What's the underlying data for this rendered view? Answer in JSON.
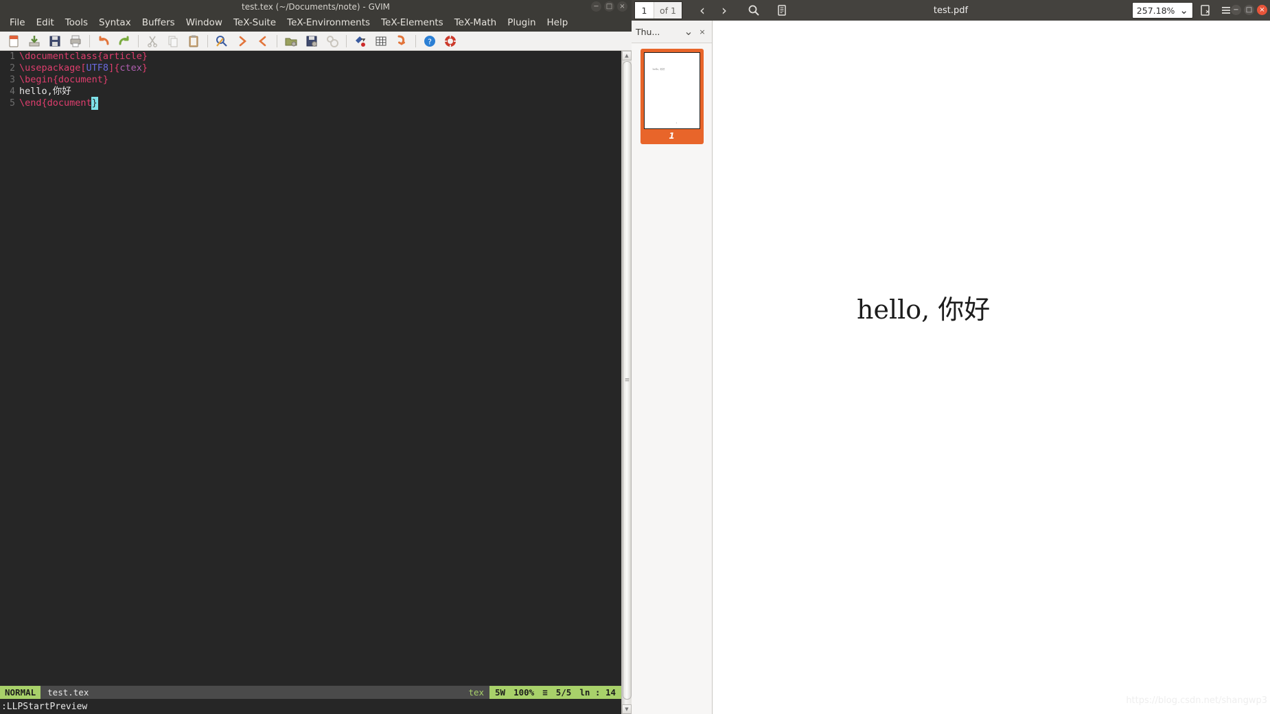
{
  "editor_window": {
    "title": "test.tex (~/Documents/note) - GVIM",
    "window_controls": [
      {
        "name": "minimize",
        "glyph": "−"
      },
      {
        "name": "maximize",
        "glyph": "□"
      },
      {
        "name": "close",
        "glyph": "×"
      }
    ],
    "menu": [
      "File",
      "Edit",
      "Tools",
      "Syntax",
      "Buffers",
      "Window",
      "TeX-Suite",
      "TeX-Environments",
      "TeX-Elements",
      "TeX-Math",
      "Plugin",
      "Help"
    ],
    "toolbar_icons": [
      "new-file-icon",
      "open-file-icon",
      "save-icon",
      "print-icon",
      "separator",
      "undo-icon",
      "redo-icon",
      "separator",
      "cut-icon",
      "copy-icon",
      "paste-icon",
      "separator",
      "find-icon",
      "find-next-icon",
      "find-previous-icon",
      "separator",
      "load-session-icon",
      "save-session-icon",
      "run-script-icon",
      "separator",
      "make-icon",
      "tags-icon",
      "run-icon",
      "separator",
      "help-icon",
      "find-help-icon"
    ],
    "code": [
      {
        "number": "1",
        "tokens": [
          {
            "text": "\\documentclass",
            "cls": "tk-cmd"
          },
          {
            "text": "{article}",
            "cls": "tk-brace"
          }
        ]
      },
      {
        "number": "2",
        "tokens": [
          {
            "text": "\\usepackage",
            "cls": "tk-cmd"
          },
          {
            "text": "[",
            "cls": "tk-brace"
          },
          {
            "text": "UTF8",
            "cls": "tk-opt"
          },
          {
            "text": "]",
            "cls": "tk-brace"
          },
          {
            "text": "{",
            "cls": "tk-brace"
          },
          {
            "text": "ctex",
            "cls": "tk-arg"
          },
          {
            "text": "}",
            "cls": "tk-brace"
          }
        ]
      },
      {
        "number": "3",
        "tokens": [
          {
            "text": "\\begin",
            "cls": "tk-cmd"
          },
          {
            "text": "{document}",
            "cls": "tk-brace"
          }
        ]
      },
      {
        "number": "4",
        "tokens": [
          {
            "text": "hello,你好",
            "cls": "tk-plain"
          }
        ]
      },
      {
        "number": "5",
        "tokens": [
          {
            "text": "\\end",
            "cls": "tk-cmd"
          },
          {
            "text": "{document",
            "cls": "tk-brace"
          },
          {
            "text": "}",
            "cls": "cursor-blk"
          }
        ]
      }
    ],
    "statusline": {
      "mode": "NORMAL",
      "filename": "test.tex",
      "filetype": "tex",
      "encoding_tag": "5W",
      "percent": "100%",
      "list_icon": "≡",
      "position": "5/5",
      "column_label": "ln  :  14"
    },
    "command_line": ":LLPStartPreview",
    "scrollbar": {
      "up_arrow": "▲",
      "down_arrow": "▼",
      "grip": "≡"
    }
  },
  "pdf_window": {
    "title": "test.pdf",
    "page_current": "1",
    "page_total": "of 1",
    "toolbar_buttons": [
      {
        "name": "previous-page-icon",
        "glyph": "‹"
      },
      {
        "name": "next-page-icon",
        "glyph": "›"
      },
      {
        "name": "search-icon",
        "glyph": "⚲"
      },
      {
        "name": "annotations-icon",
        "glyph": "☷"
      }
    ],
    "zoom": "257.18%",
    "zoom_caret": "⌄",
    "right_buttons": [
      {
        "name": "presentation-mode-icon",
        "glyph": "⧉"
      },
      {
        "name": "menu-icon",
        "glyph": "☰"
      }
    ],
    "window_controls": [
      {
        "name": "minimize",
        "glyph": "−"
      },
      {
        "name": "maximize",
        "glyph": "□"
      },
      {
        "name": "close",
        "glyph": "×"
      }
    ],
    "sidebar": {
      "label": "Thu...",
      "dropdown_glyph": "⌄",
      "close_glyph": "×",
      "thumbnail": {
        "page_label": "1",
        "preview_text": "hello, 你好",
        "footer_dot": "1"
      }
    },
    "document_text": "hello, 你好",
    "watermark": "https://blog.csdn.net/shangwp3"
  },
  "colors": {
    "gvim_chrome": "#3c3b37",
    "gvim_editor_bg": "#262626",
    "status_green": "#a8d16a",
    "pdf_chrome": "#44423e",
    "thumb_orange": "#e8652a",
    "latex_pink": "#e03e6e",
    "cursor_cyan": "#7ee0e8"
  }
}
